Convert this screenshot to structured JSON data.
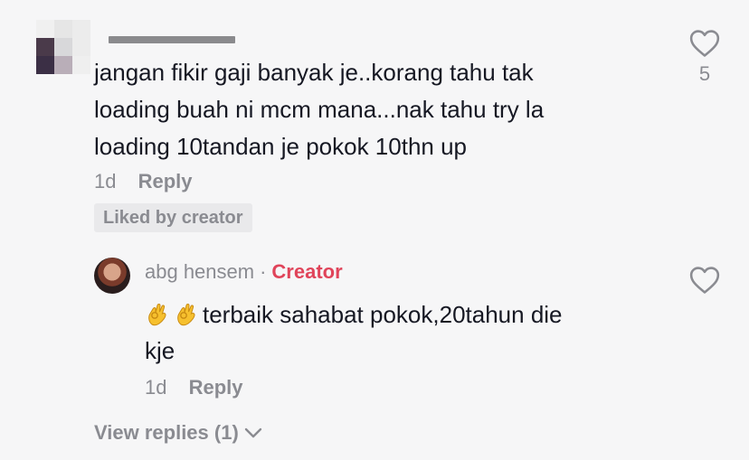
{
  "comment": {
    "text_lines": [
      "jangan fikir gaji banyak je..korang tahu tak",
      "loading buah ni mcm mana...nak tahu try la",
      "loading 10tandan je pokok 10thn up"
    ],
    "time": "1d",
    "reply_label": "Reply",
    "liked_badge": "Liked by creator",
    "like_count": "5"
  },
  "reply": {
    "username": "abg hensem",
    "separator": "·",
    "creator_label": "Creator",
    "text_line1": "terbaik sahabat pokok,20tahun die",
    "text_line2": "kje",
    "time": "1d",
    "reply_label": "Reply"
  },
  "view_replies": "View replies (1)",
  "icons": {
    "like": "heart-outline-icon",
    "expand": "chevron-down-icon",
    "emoji": "ok-hand-emoji"
  },
  "colors": {
    "background": "#f6f6f7",
    "text": "#161823",
    "muted": "#8a8b91",
    "creator": "#e0445a"
  }
}
